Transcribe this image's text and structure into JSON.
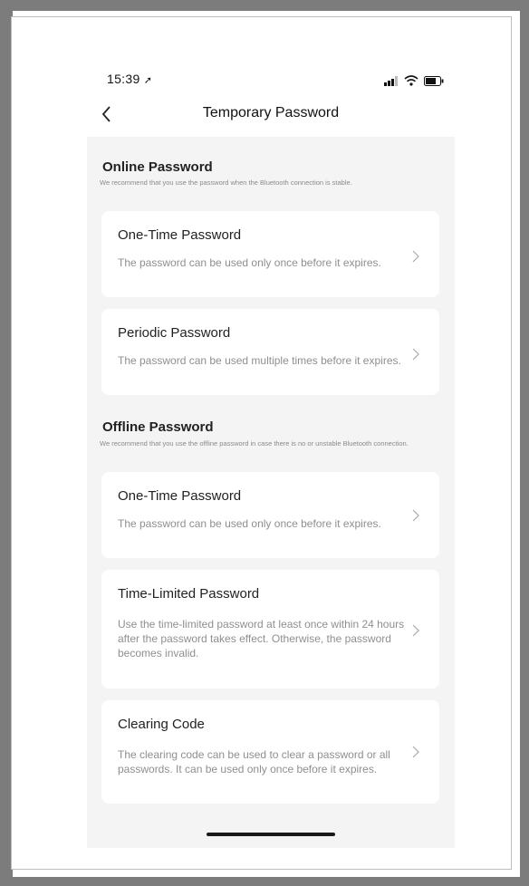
{
  "status_bar": {
    "time": "15:39"
  },
  "nav": {
    "title": "Temporary Password"
  },
  "sections": [
    {
      "title": "Online Password",
      "description": "We recommend that you use the password when the Bluetooth connection is stable.",
      "cards": [
        {
          "title": "One-Time Password",
          "description": "The password can be used only once before it expires."
        },
        {
          "title": "Periodic Password",
          "description": "The password can be used multiple times before it expires."
        }
      ]
    },
    {
      "title": "Offline Password",
      "description": "We recommend that you use the offline password in case there is no or unstable Bluetooth connection.",
      "cards": [
        {
          "title": "One-Time Password",
          "description": "The password can be used only once before it expires."
        },
        {
          "title": "Time-Limited Password",
          "description": "Use the time-limited password at least once within 24 hours after the password takes effect. Otherwise, the password becomes invalid."
        },
        {
          "title": "Clearing Code",
          "description": "The clearing code can be used to clear a password or all passwords. It can be used only once before it expires."
        }
      ]
    }
  ]
}
